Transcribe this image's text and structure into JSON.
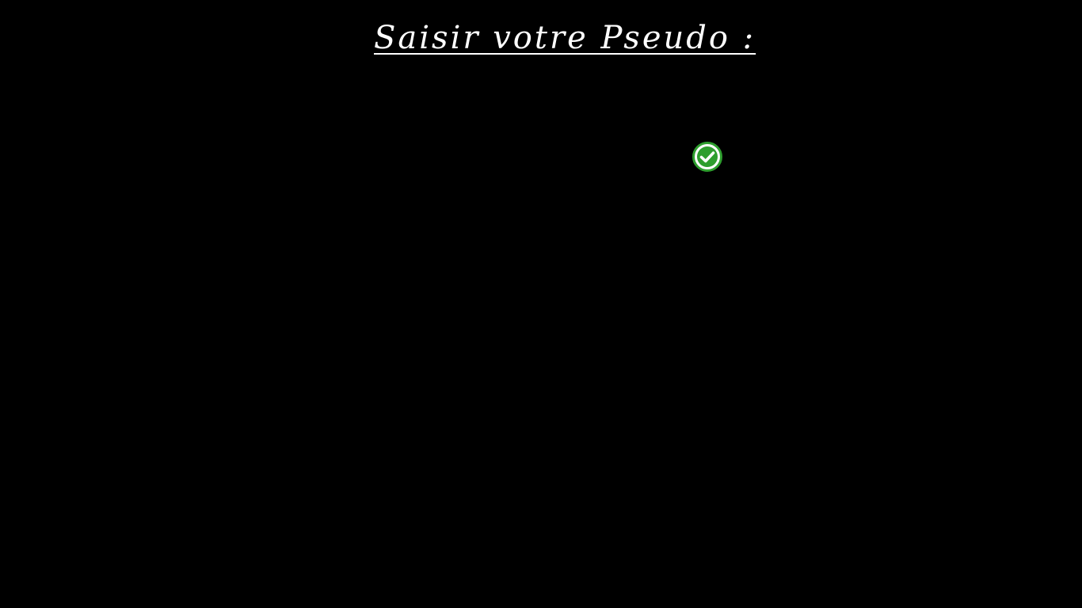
{
  "header": {
    "title": "Saisir votre Pseudo :"
  },
  "form": {
    "pseudo_value": "",
    "validate_icon": "check-circle-icon",
    "validate_color": "#2e9e2e",
    "validate_check_color": "#ffffff"
  },
  "colors": {
    "background": "#000000",
    "text": "#ffffff"
  }
}
